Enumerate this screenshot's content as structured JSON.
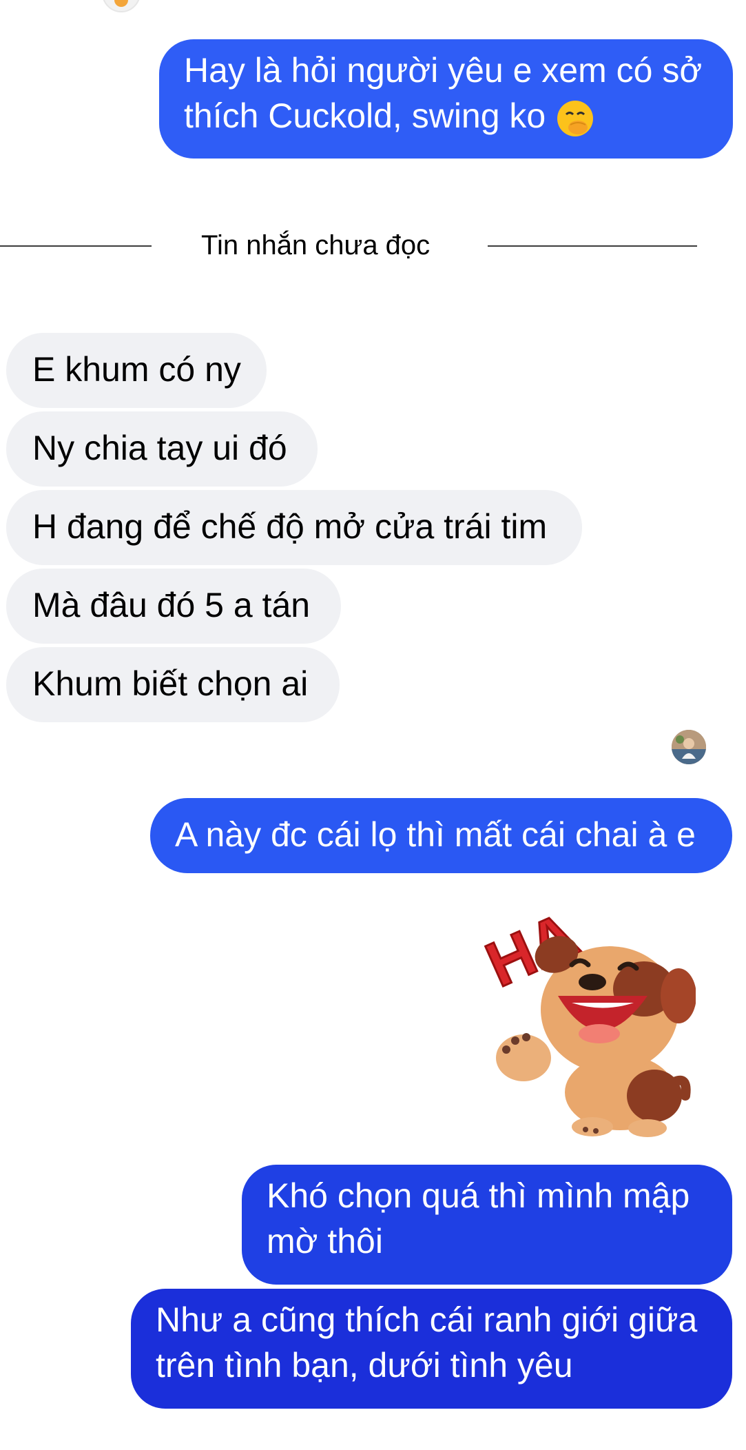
{
  "colors": {
    "outgoing_top": "#2f5cf5",
    "outgoing_bottom": "#1f2fd8",
    "incoming_bg": "#f0f1f4",
    "divider": "#3c3c3c"
  },
  "outgoing_1": {
    "line1": "Hay là hỏi người yêu e xem có sở",
    "line2": "thích Cuckold, swing ko",
    "emoji": "face-with-hand-over-mouth-icon"
  },
  "divider": {
    "label": "Tin nhắn chưa đọc"
  },
  "incoming": [
    {
      "text": "E khum có ny"
    },
    {
      "text": "Ny chia tay ui đó"
    },
    {
      "text": "H đang để chế độ mở cửa trái tim"
    },
    {
      "text": "Mà đâu đó 5 a tán"
    },
    {
      "text": "Khum biết chọn ai"
    }
  ],
  "outgoing_2": {
    "text": "A này đc cái lọ thì mất cái chai à e"
  },
  "sticker": {
    "text": "HA",
    "icon": "laughing-dog-sticker-icon"
  },
  "outgoing_3": {
    "line1": "Khó chọn quá thì mình mập",
    "line2": "mờ thôi"
  },
  "outgoing_4": {
    "line1": "Như a cũng thích cái ranh giới giữa",
    "line2": "trên tình bạn, dưới tình yêu"
  }
}
